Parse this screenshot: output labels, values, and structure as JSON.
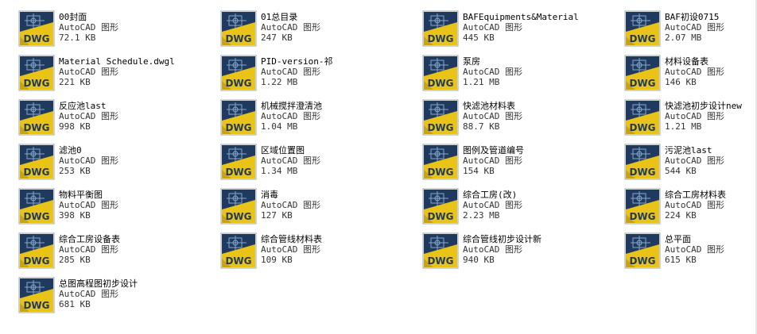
{
  "file_type_label": "AutoCAD 图形",
  "icon_badge": "DWG",
  "icon_name": "dwg-file-icon",
  "colors": {
    "icon_bg": "#1f3a5e",
    "icon_fold": "#e9c318",
    "badge_text": "#1f3a5e"
  },
  "files": [
    {
      "name": "00封面",
      "type": "AutoCAD 图形",
      "size": "72.1 KB"
    },
    {
      "name": "01总目录",
      "type": "AutoCAD 图形",
      "size": "247 KB"
    },
    {
      "name": "BAFEquipments&Material",
      "type": "AutoCAD 图形",
      "size": "445 KB"
    },
    {
      "name": "BAF初设0715",
      "type": "AutoCAD 图形",
      "size": "2.07 MB"
    },
    {
      "name": "Material Schedule.dwgl",
      "type": "AutoCAD 图形",
      "size": "221 KB"
    },
    {
      "name": "PID-version-祁",
      "type": "AutoCAD 图形",
      "size": "1.22 MB"
    },
    {
      "name": "泵房",
      "type": "AutoCAD 图形",
      "size": "1.21 MB"
    },
    {
      "name": "材料设备表",
      "type": "AutoCAD 图形",
      "size": "146 KB"
    },
    {
      "name": "反应池last",
      "type": "AutoCAD 图形",
      "size": "998 KB"
    },
    {
      "name": "机械搅拌澄清池",
      "type": "AutoCAD 图形",
      "size": "1.04 MB"
    },
    {
      "name": "快滤池材料表",
      "type": "AutoCAD 图形",
      "size": "88.7 KB"
    },
    {
      "name": "快滤池初步设计new",
      "type": "AutoCAD 图形",
      "size": "1.21 MB"
    },
    {
      "name": "滤池0",
      "type": "AutoCAD 图形",
      "size": "253 KB"
    },
    {
      "name": "区域位置图",
      "type": "AutoCAD 图形",
      "size": "1.34 MB"
    },
    {
      "name": "图例及管道编号",
      "type": "AutoCAD 图形",
      "size": "154 KB"
    },
    {
      "name": "污泥池last",
      "type": "AutoCAD 图形",
      "size": "544 KB"
    },
    {
      "name": "物料平衡图",
      "type": "AutoCAD 图形",
      "size": "398 KB"
    },
    {
      "name": "消毒",
      "type": "AutoCAD 图形",
      "size": "127 KB"
    },
    {
      "name": "综合工房(改)",
      "type": "AutoCAD 图形",
      "size": "2.23 MB"
    },
    {
      "name": "综合工房材料表",
      "type": "AutoCAD 图形",
      "size": "224 KB"
    },
    {
      "name": "综合工房设备表",
      "type": "AutoCAD 图形",
      "size": "285 KB"
    },
    {
      "name": "综合管线材料表",
      "type": "AutoCAD 图形",
      "size": "109 KB"
    },
    {
      "name": "综合管线初步设计新",
      "type": "AutoCAD 图形",
      "size": "940 KB"
    },
    {
      "name": "总平面",
      "type": "AutoCAD 图形",
      "size": "615 KB"
    },
    {
      "name": "总图高程图初步设计",
      "type": "AutoCAD 图形",
      "size": "681 KB"
    }
  ]
}
